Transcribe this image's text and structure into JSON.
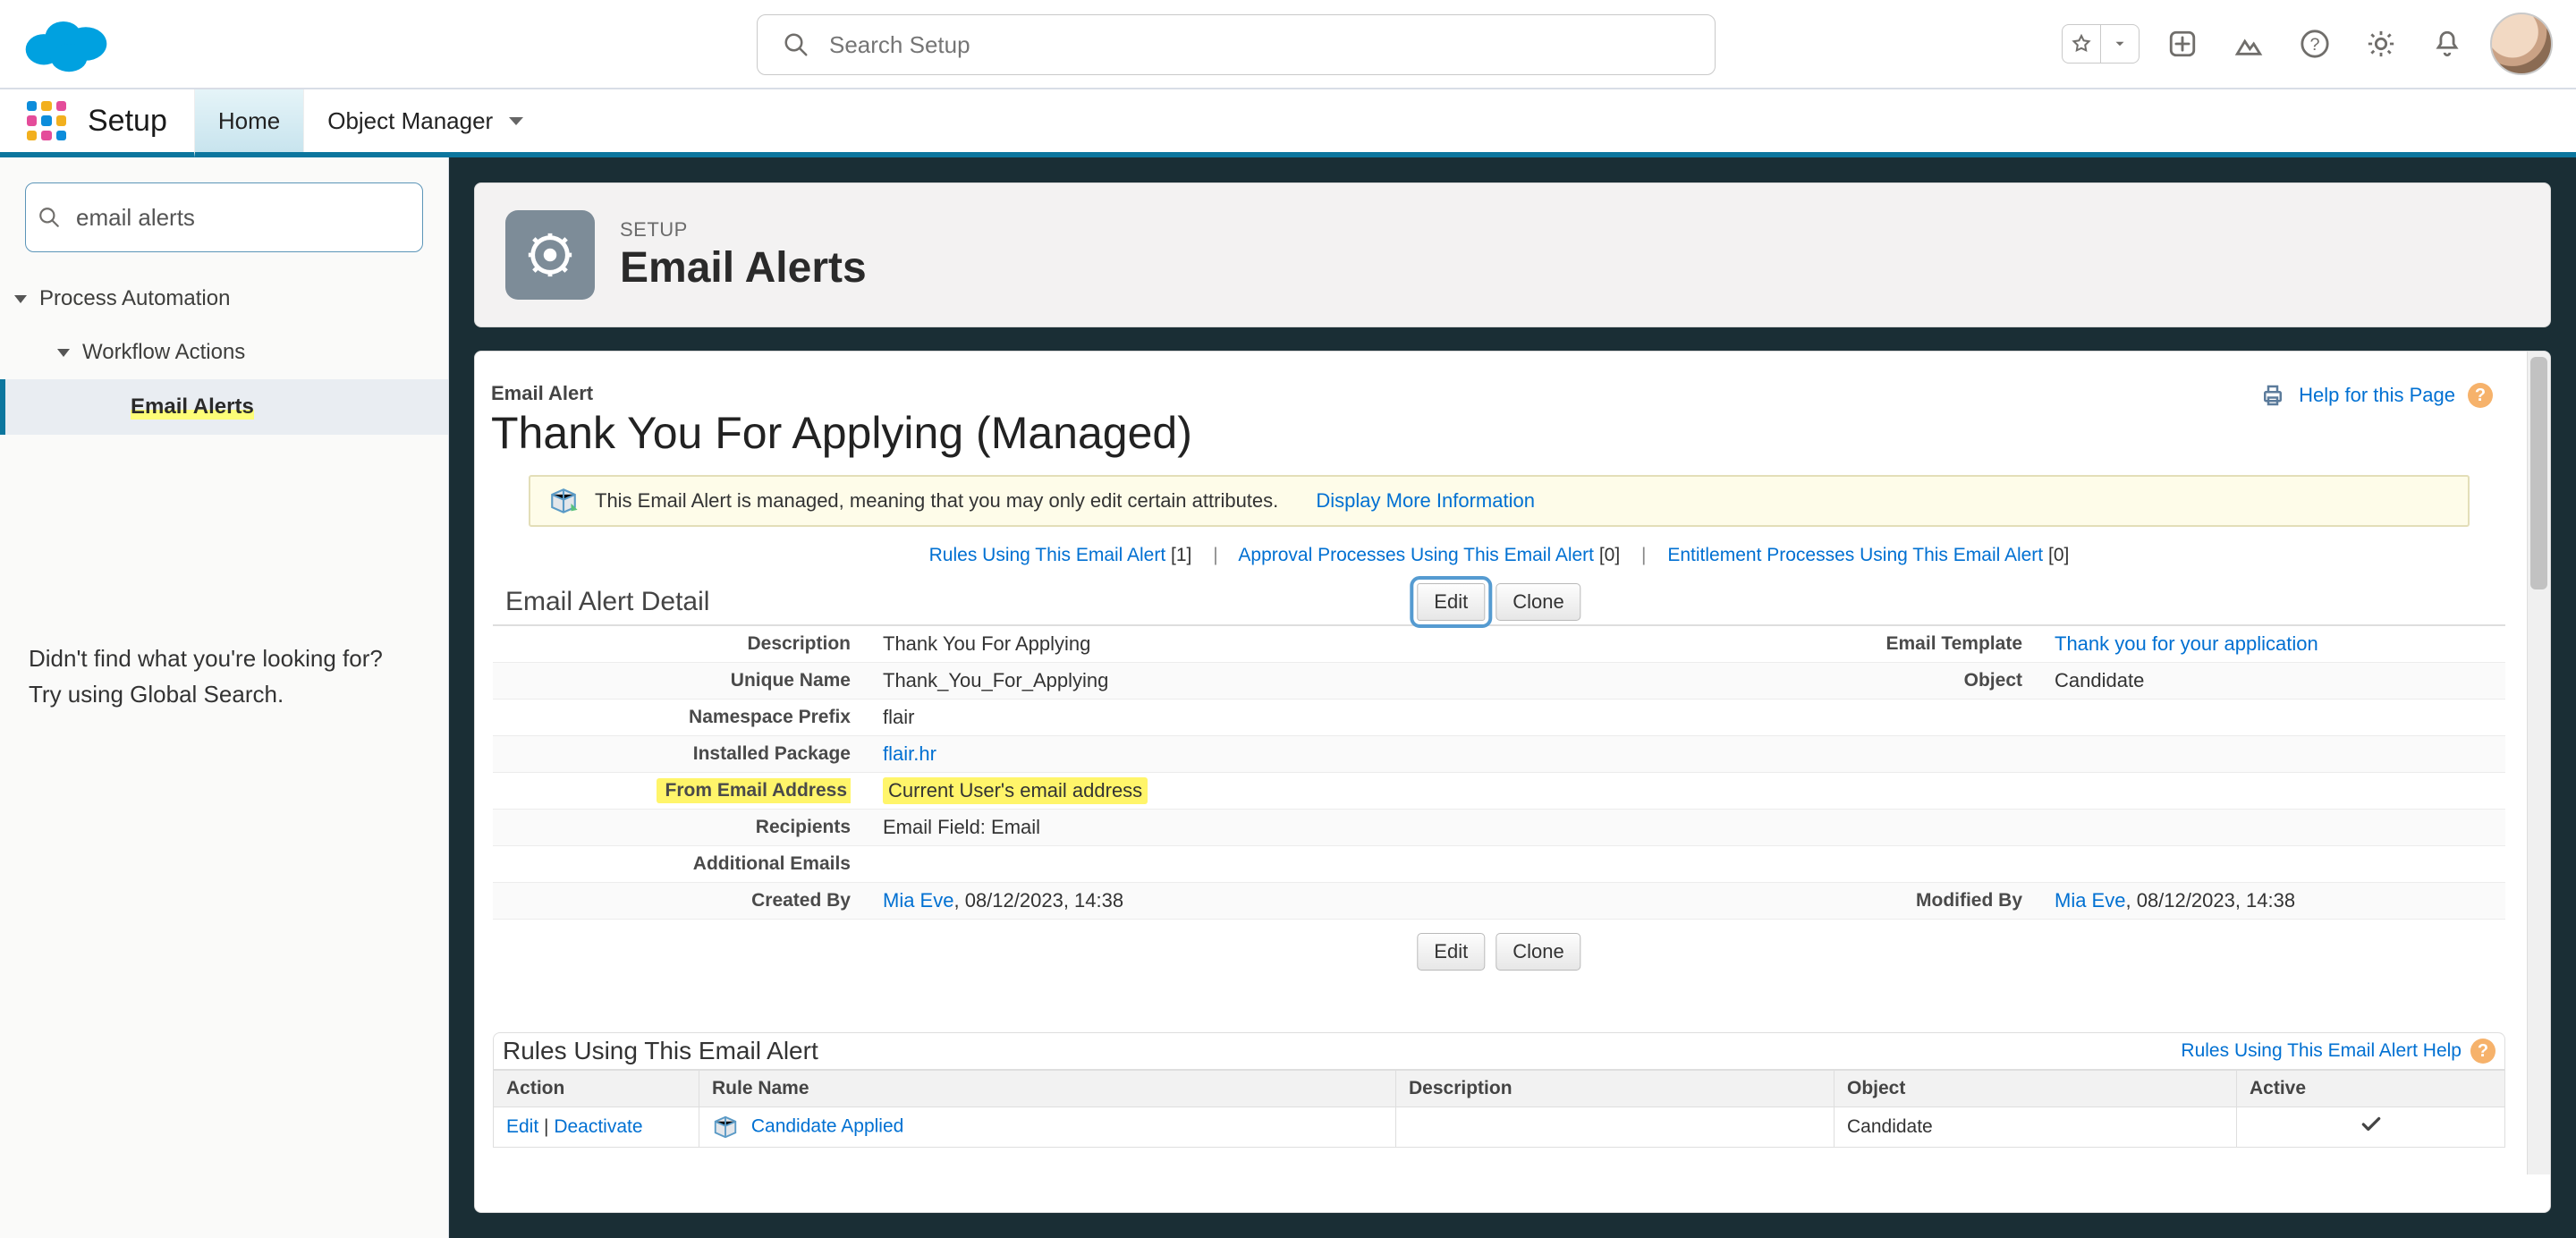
{
  "global_header": {
    "search_placeholder": "Search Setup"
  },
  "context_bar": {
    "app_name": "Setup",
    "items": [
      {
        "label": "Home"
      },
      {
        "label": "Object Manager"
      }
    ]
  },
  "sidebar": {
    "quick_find_value": "email alerts",
    "tree": {
      "node1": {
        "label": "Process Automation"
      },
      "node2": {
        "label": "Workflow Actions"
      },
      "node3": {
        "label": "Email Alerts"
      }
    },
    "hint_line1": "Didn't find what you're looking for?",
    "hint_line2": "Try using Global Search."
  },
  "page_header": {
    "breadcrumb": "SETUP",
    "title": "Email Alerts"
  },
  "record": {
    "type_label": "Email Alert",
    "name": "Thank You For Applying (Managed)",
    "help_label": "Help for this Page"
  },
  "managed_note": {
    "text": "This Email Alert is managed, meaning that you may only edit certain attributes.",
    "link": "Display More Information"
  },
  "related_links": {
    "rules": {
      "text": "Rules Using This Email Alert",
      "count": "[1]"
    },
    "approval": {
      "text": "Approval Processes Using This Email Alert",
      "count": "[0]"
    },
    "entitlement": {
      "text": "Entitlement Processes Using This Email Alert",
      "count": "[0]"
    },
    "separator": "|"
  },
  "detail_section": {
    "title": "Email Alert Detail",
    "buttons": {
      "edit": "Edit",
      "clone": "Clone"
    }
  },
  "details": {
    "description": {
      "label": "Description",
      "value": "Thank You For Applying"
    },
    "email_template": {
      "label": "Email Template",
      "value": "Thank you for your application"
    },
    "unique_name": {
      "label": "Unique Name",
      "value": "Thank_You_For_Applying"
    },
    "object": {
      "label": "Object",
      "value": "Candidate"
    },
    "namespace": {
      "label": "Namespace Prefix",
      "value": "flair"
    },
    "installed_package": {
      "label": "Installed Package",
      "value": "flair.hr"
    },
    "from_email": {
      "label": "From Email Address",
      "value": "Current User's email address"
    },
    "recipients": {
      "label": "Recipients",
      "value": "Email Field: Email"
    },
    "additional_emails": {
      "label": "Additional Emails",
      "value": ""
    },
    "created_by": {
      "label": "Created By",
      "user": "Mia Eve",
      "ts": ", 08/12/2023, 14:38"
    },
    "modified_by": {
      "label": "Modified By",
      "user": "Mia Eve",
      "ts": ", 08/12/2023, 14:38"
    }
  },
  "related_list": {
    "title": "Rules Using This Email Alert",
    "help": "Rules Using This Email Alert Help",
    "columns": {
      "action": "Action",
      "rule": "Rule Name",
      "desc": "Description",
      "obj": "Object",
      "active": "Active"
    },
    "row": {
      "action_edit": "Edit",
      "action_sep": " | ",
      "action_deact": "Deactivate",
      "rule_name": "Candidate Applied",
      "description": "",
      "object": "Candidate",
      "active": true
    }
  }
}
